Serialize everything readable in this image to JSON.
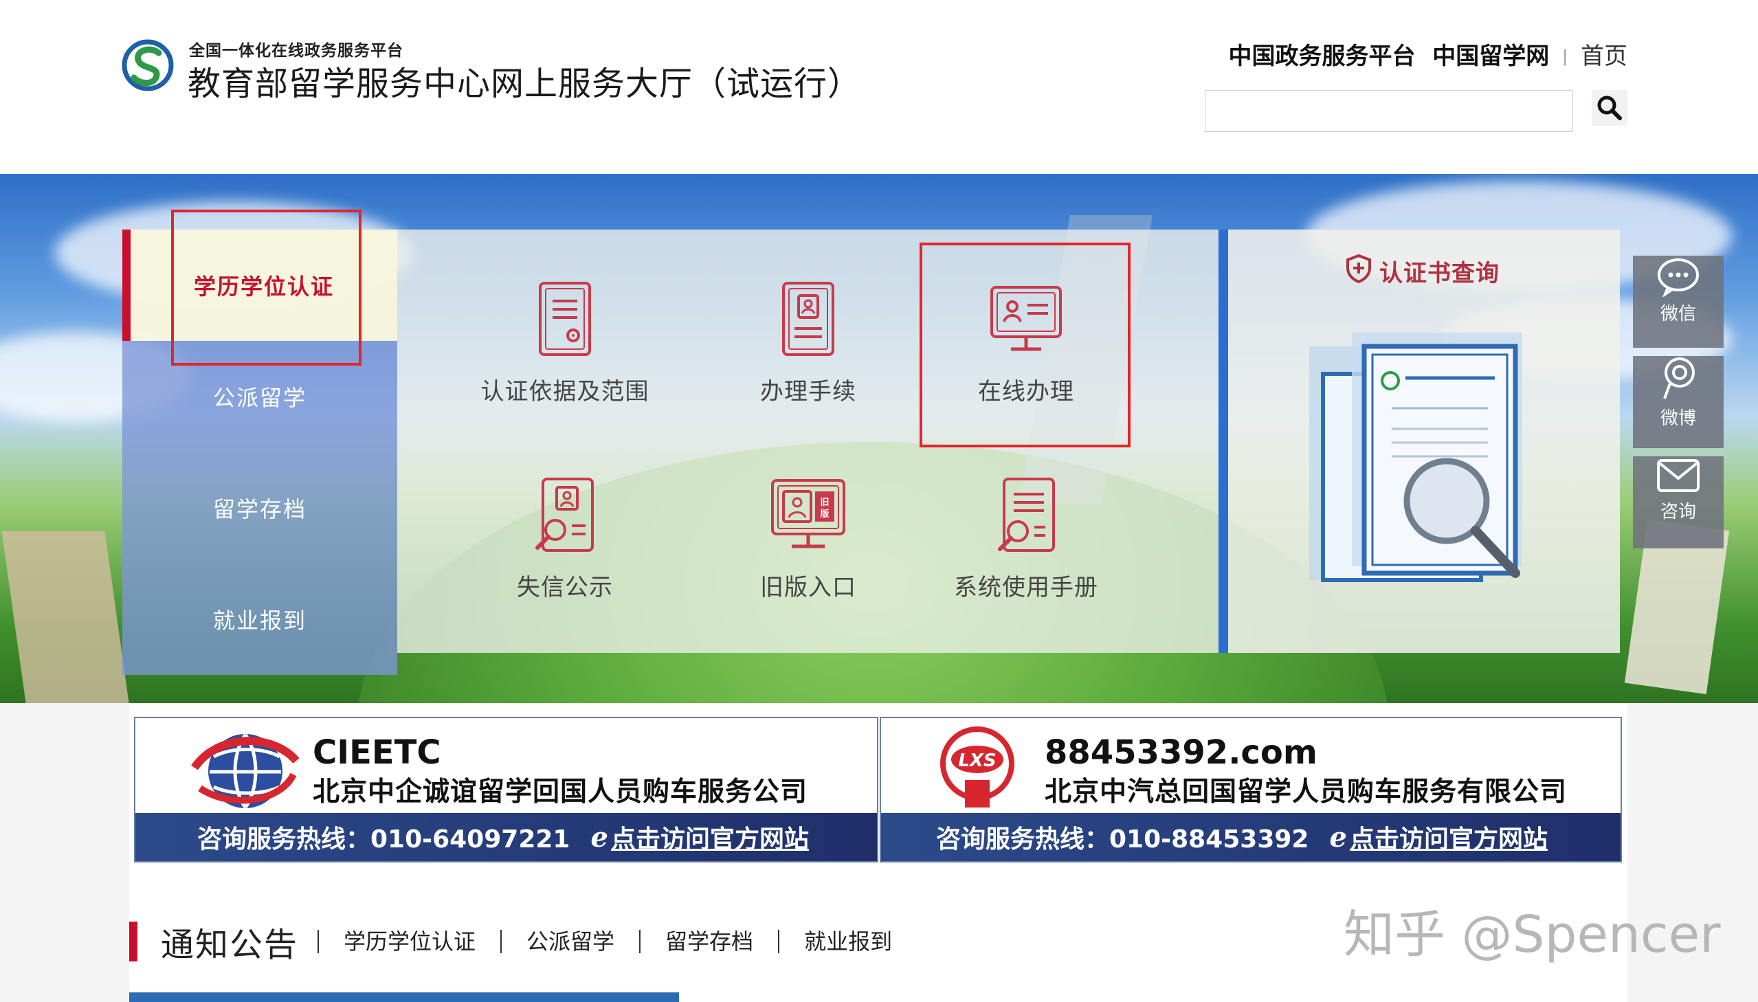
{
  "header": {
    "platform_subtitle": "全国一体化在线政务服务平台",
    "site_title": "教育部留学服务中心网上服务大厅（试运行）",
    "top_links": [
      "中国政务服务平台",
      "中国留学网"
    ],
    "home_link": "首页",
    "search_value": ""
  },
  "left_nav": {
    "items": [
      {
        "label": "学历学位认证",
        "active": true
      },
      {
        "label": "公派留学",
        "active": false
      },
      {
        "label": "留学存档",
        "active": false
      },
      {
        "label": "就业报到",
        "active": false
      }
    ]
  },
  "services": {
    "items": [
      {
        "label": "认证依据及范围",
        "icon": "document-seal-icon"
      },
      {
        "label": "办理手续",
        "icon": "id-profile-icon"
      },
      {
        "label": "在线办理",
        "icon": "monitor-profile-icon"
      },
      {
        "label": "失信公示",
        "icon": "profile-search-icon"
      },
      {
        "label": "旧版入口",
        "icon": "monitor-old-version-icon"
      },
      {
        "label": "系统使用手册",
        "icon": "manual-search-icon"
      }
    ],
    "old_badge": "旧版"
  },
  "cert_query": {
    "title": "认证书查询",
    "icon": "shield-plus-icon"
  },
  "side_float": [
    {
      "label": "微信",
      "icon": "wechat-icon"
    },
    {
      "label": "微博",
      "icon": "weibo-icon"
    },
    {
      "label": "咨询",
      "icon": "mail-icon"
    }
  ],
  "ads": [
    {
      "name": "CIEETC",
      "company": "北京中企诚谊留学回国人员购车服务公司",
      "hotline": "咨询服务热线：010-64097221",
      "visit": "点击访问官方网站"
    },
    {
      "name": "88453392.com",
      "company": "北京中汽总回国留学人员购车服务有限公司",
      "hotline": "咨询服务热线：010-88453392",
      "visit": "点击访问官方网站",
      "logo_text": "LXS"
    }
  ],
  "notices": {
    "heading": "通知公告",
    "tabs": [
      "学历学位认证",
      "公派留学",
      "留学存档",
      "就业报到"
    ]
  },
  "watermark": "知乎 @Spencer",
  "colors": {
    "accent_red": "#c8102e",
    "highlight_red": "#e2252b",
    "nav_blue": "#7e96d7",
    "divider_blue": "#2a6ed0"
  }
}
